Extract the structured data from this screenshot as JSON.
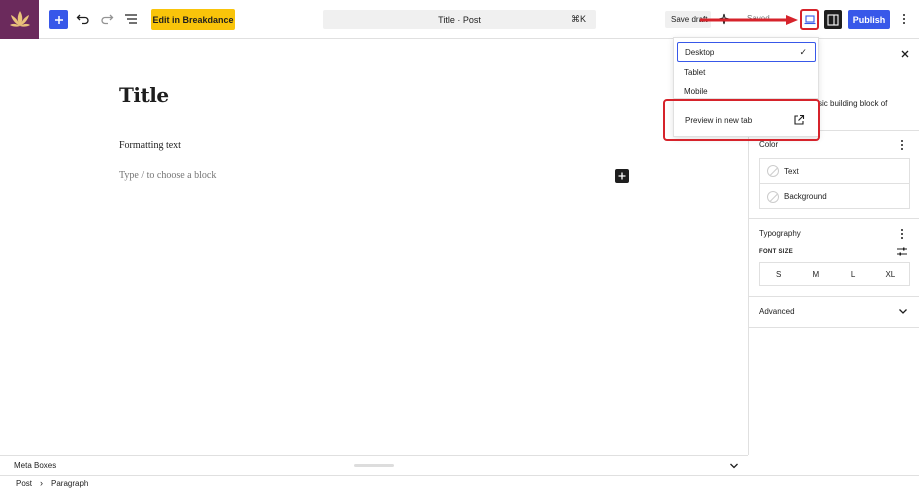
{
  "toolbar": {
    "logo_icon": "lotus-logo-icon",
    "breakdance_label": "Edit in Breakdance",
    "command_bar_label": "Title · Post",
    "command_bar_shortcut": "⌘K",
    "save_draft_label": "Save draft",
    "saved_label": "Saved",
    "publish_label": "Publish",
    "accent_color": "#3858e9",
    "breakdance_color": "#f9c40a"
  },
  "editor": {
    "title": "Title",
    "paragraph": "Formatting text",
    "placeholder": "Type / to choose a block"
  },
  "preview_menu": {
    "options": [
      "Desktop",
      "Tablet",
      "Mobile"
    ],
    "selected": "Desktop",
    "check_mark": "✓",
    "preview_new_tab": "Preview in new tab"
  },
  "sidebar": {
    "description": "sic building block of",
    "color": {
      "heading": "Color",
      "options": [
        "Text",
        "Background"
      ]
    },
    "typography": {
      "heading": "Typography",
      "font_size_label": "FONT SIZE",
      "sizes": [
        "S",
        "M",
        "L",
        "XL"
      ]
    },
    "advanced": "Advanced"
  },
  "meta_boxes": {
    "label": "Meta Boxes"
  },
  "breadcrumb": {
    "items": [
      "Post",
      "Paragraph"
    ],
    "separator": "›"
  },
  "annotation_color": "#d6232b"
}
